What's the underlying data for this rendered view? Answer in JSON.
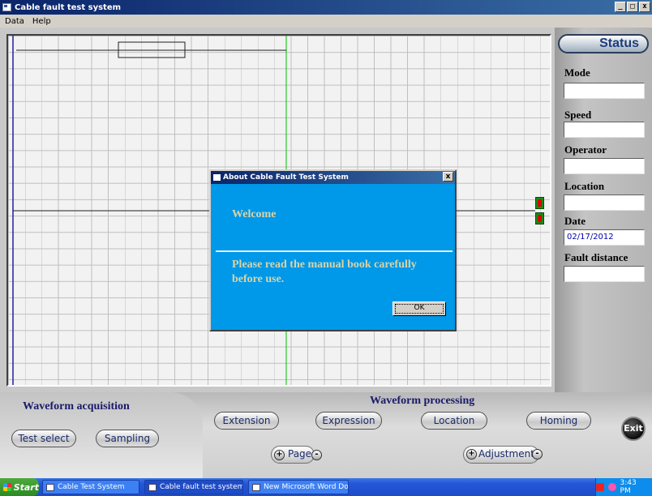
{
  "window": {
    "title": "Cable fault test system",
    "controls": [
      "_",
      "□",
      "x"
    ]
  },
  "menu": [
    "Data",
    "Help"
  ],
  "status": {
    "title": "Status",
    "fields": [
      {
        "label": "Mode",
        "value": ""
      },
      {
        "label": "Speed",
        "value": ""
      },
      {
        "label": "Operator",
        "value": ""
      },
      {
        "label": "Location",
        "value": ""
      },
      {
        "label": "Date",
        "value": "02/17/2012"
      },
      {
        "label": "Fault distance",
        "value": ""
      }
    ]
  },
  "acquisition": {
    "title": "Waveform acquisition",
    "test_select": "Test select",
    "sampling": "Sampling"
  },
  "processing": {
    "title": "Waveform processing",
    "extension": "Extension",
    "expression": "Expression",
    "location": "Location",
    "homing": "Homing",
    "page": "Page",
    "adjustment": "Adjustment",
    "plus": "+",
    "minus": "-"
  },
  "exit_label": "Exit",
  "dialog": {
    "title": "About Cable Fault Test System",
    "close": "x",
    "welcome": "Welcome",
    "message": "Please read the manual book carefully before use.",
    "ok": "OK"
  },
  "taskbar": {
    "start": "Start",
    "items": [
      "Cable Test System",
      "Cable fault test system",
      "New Microsoft Word Doc..."
    ],
    "time": "3:43 PM"
  },
  "colors": {
    "dialog_bg": "#0098e8",
    "dialog_text": "#d8d4a8",
    "cursor_line": "#00c000",
    "baseline": "#2020a0"
  }
}
